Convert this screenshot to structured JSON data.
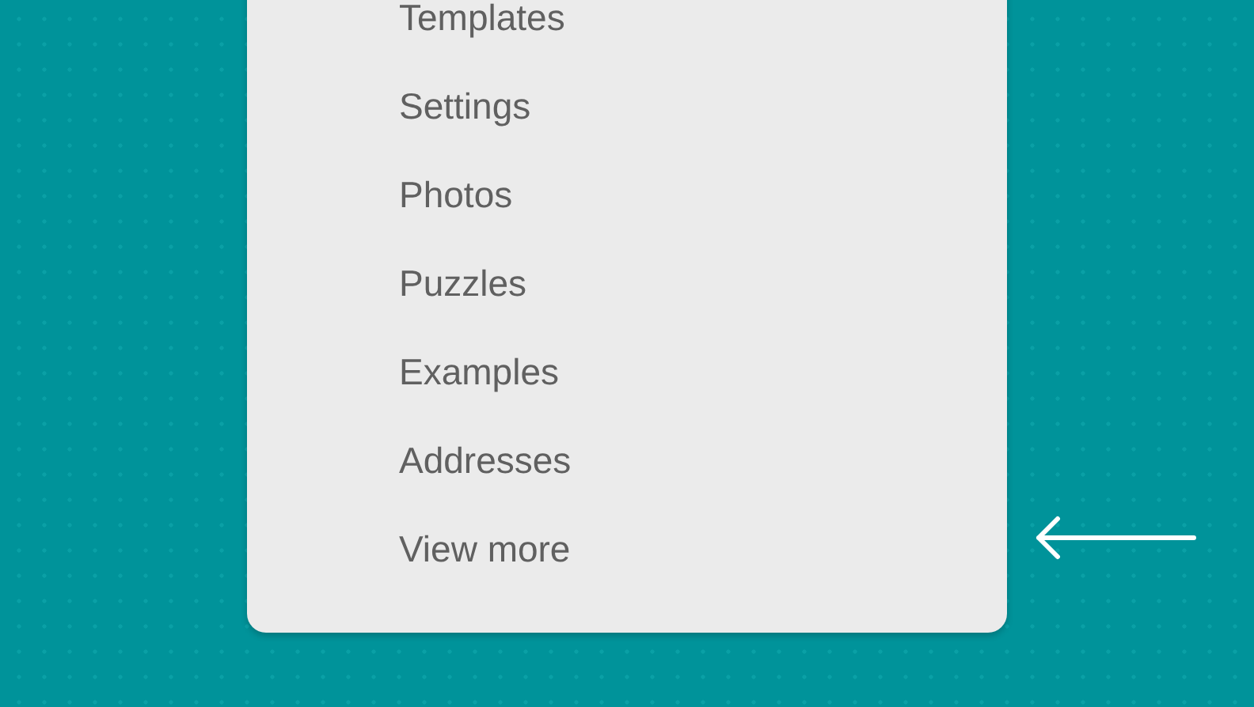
{
  "menu": {
    "items": [
      {
        "label": "Templates"
      },
      {
        "label": "Settings"
      },
      {
        "label": "Photos"
      },
      {
        "label": "Puzzles"
      },
      {
        "label": "Examples"
      },
      {
        "label": "Addresses"
      },
      {
        "label": "View more"
      }
    ]
  }
}
